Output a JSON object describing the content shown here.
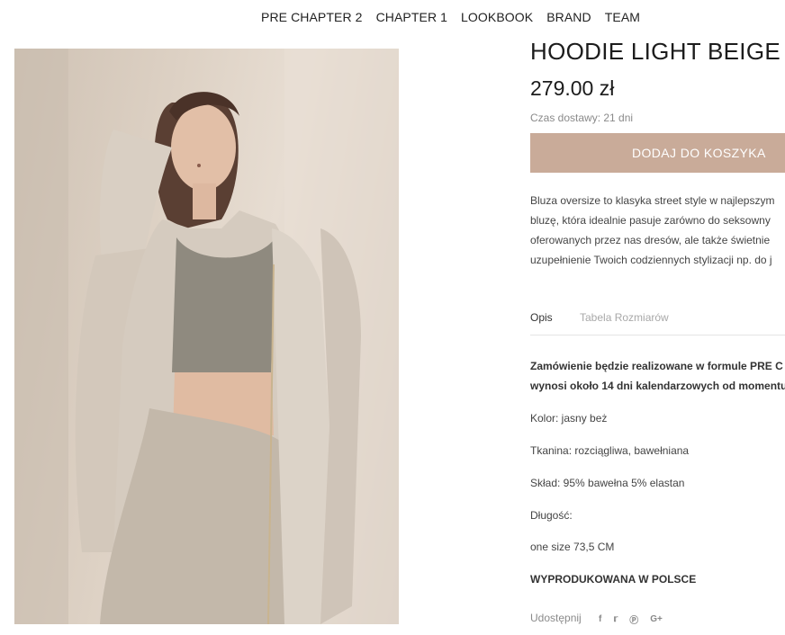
{
  "nav": {
    "links": [
      "PRE CHAPTER 2",
      "CHAPTER 1",
      "LOOKBOOK",
      "BRAND",
      "TEAM"
    ]
  },
  "product": {
    "title": "HOODIE LIGHT BEIGE",
    "price": "279.00 zł",
    "delivery": "Czas dostawy: 21 dni",
    "add_to_cart": "DODAJ DO KOSZYKA",
    "description_lines": [
      "Bluza oversize to klasyka street style w najlepszym",
      "bluzę, która idealnie pasuje zarówno do seksowny",
      "oferowanych przez nas dresów, ale także świetnie",
      "uzupełnienie Twoich codziennych stylizacji np. do j"
    ]
  },
  "tabs": {
    "description": "Opis",
    "size_table": "Tabela Rozmiarów"
  },
  "details": {
    "order_note_line1": "Zamówienie  będzie realizowane w formule PRE C",
    "order_note_line2": "wynosi około 14 dni kalendarzowych od momentu",
    "color": "Kolor: jasny beż",
    "fabric": "Tkanina: rozciągliwa, bawełniana",
    "composition": "Skład: 95% bawełna 5% elastan",
    "length_label": "Długość:",
    "length_value": "one size 73,5 CM",
    "made_in": "WYPRODUKOWANA W POLSCE"
  },
  "share": {
    "label": "Udostępnij",
    "icons": [
      "facebook-icon",
      "twitter-icon",
      "pinterest-icon",
      "google-plus-icon"
    ]
  },
  "colors": {
    "accent": "#c9ab99",
    "muted_text": "#8a8a8a"
  }
}
